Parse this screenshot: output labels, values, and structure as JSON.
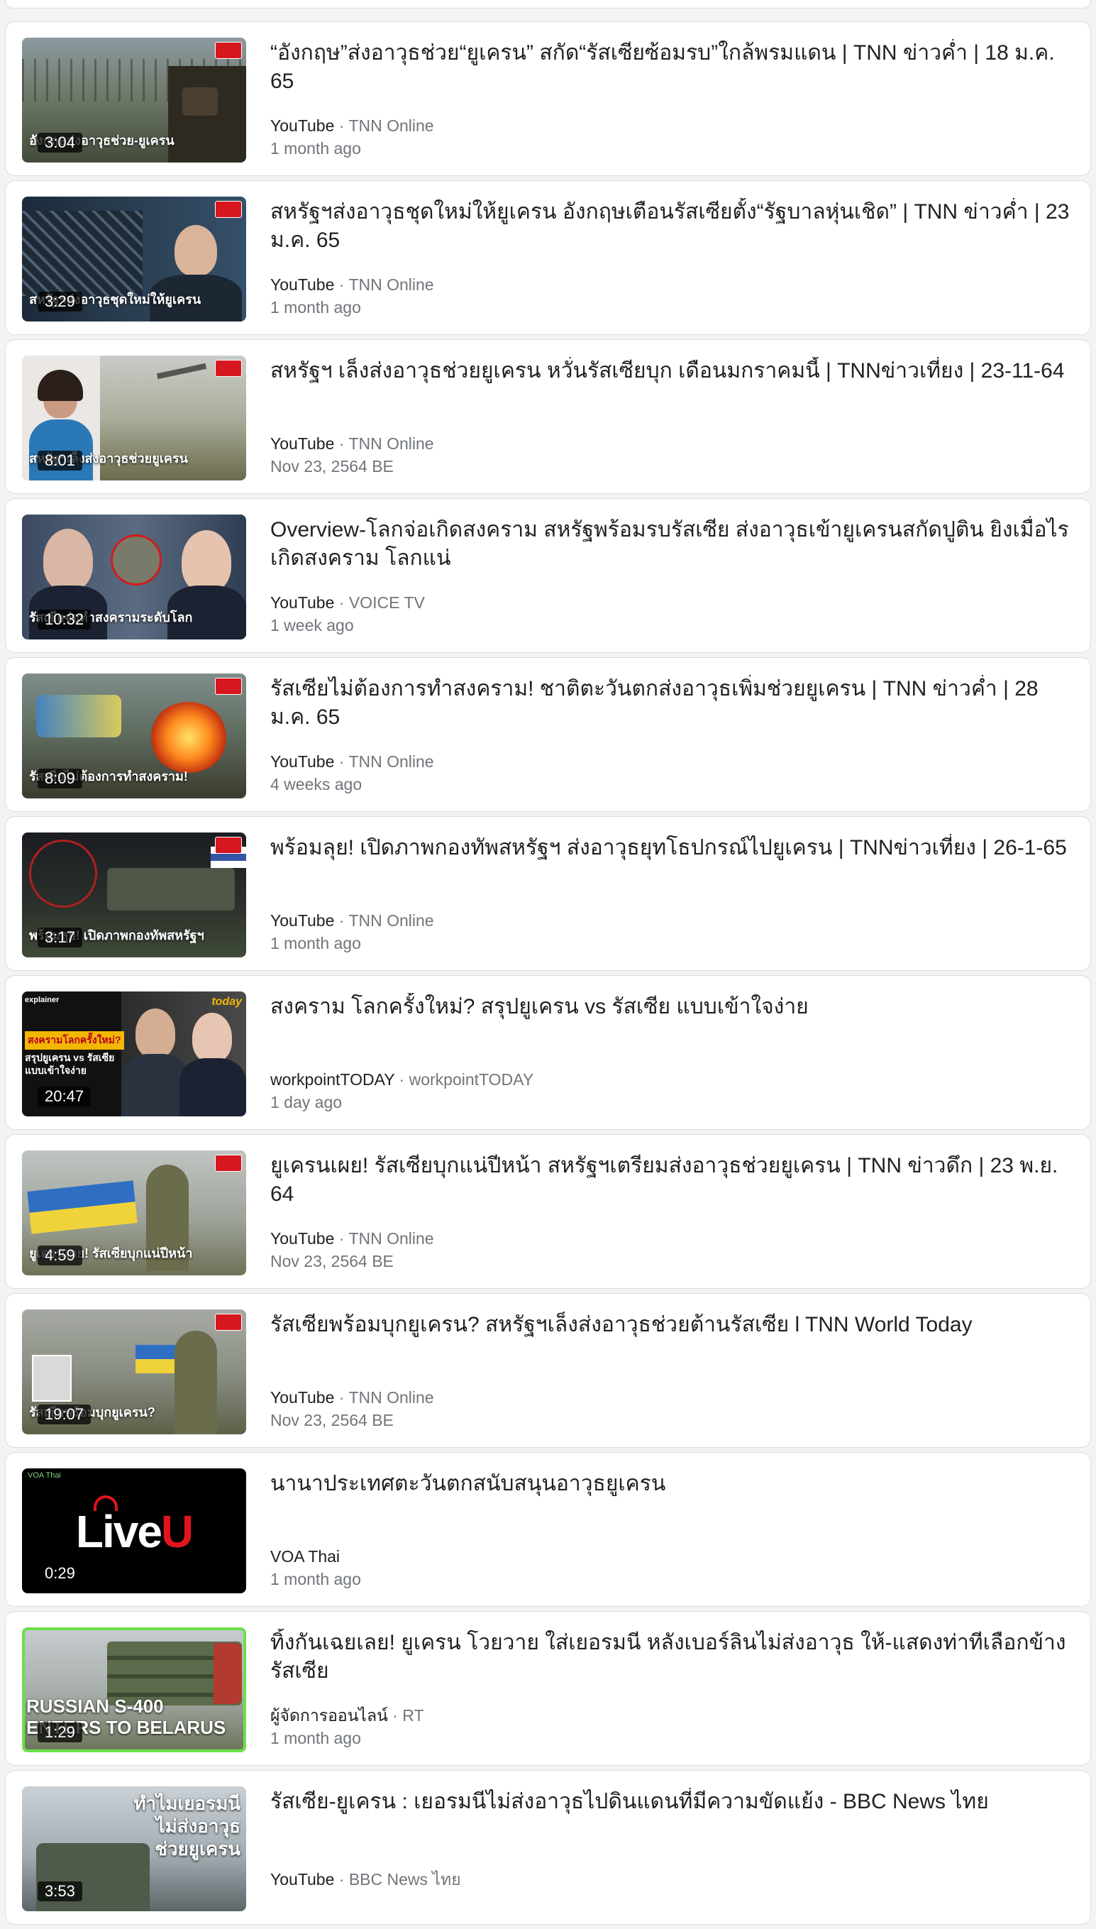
{
  "results": [
    {
      "title": "“อังกฤษ”ส่งอาวุธช่วย“ยูเครน” สกัด“รัสเซียซ้อมรบ”ใกล้พรมแดน | TNN ข่าวค่ำ | 18 ม.ค. 65",
      "source": "YouTube",
      "channel": "TNN Online",
      "date": "1 month ago",
      "duration": "3:04",
      "thumb_text": "อังกฤษส่งอาวุธช่วย-ยูเครน"
    },
    {
      "title": "สหรัฐฯส่งอาวุธชุดใหม่ให้ยูเครน อังกฤษเตือนรัสเซียตั้ง“รัฐบาลหุ่นเชิด” | TNN ข่าวค่ำ | 23 ม.ค. 65",
      "source": "YouTube",
      "channel": "TNN Online",
      "date": "1 month ago",
      "duration": "3:29",
      "thumb_text": "สหรัฐฯส่งอาวุธชุดใหม่ให้ยูเครน"
    },
    {
      "title": "สหรัฐฯ เล็งส่งอาวุธช่วยยูเครน หวั่นรัสเซียบุก เดือนมกราคมนี้ | TNNข่าวเที่ยง | 23-11-64",
      "source": "YouTube",
      "channel": "TNN Online",
      "date": "Nov 23, 2564 BE",
      "duration": "8:01",
      "thumb_text": "สหรัฐฯเล็งส่งอาวุธช่วยยูเครน"
    },
    {
      "title": "Overview-โลกจ่อเกิดสงคราม สหรัฐพร้อมรบรัสเซีย ส่งอาวุธเข้ายูเครนสกัดปูติน ยิงเมื่อไรเกิดสงคราม โลกแน่",
      "source": "YouTube",
      "channel": "VOICE TV",
      "date": "1 week ago",
      "duration": "10:32",
      "thumb_text": "รัสเซียจ่อทำสงครามระดับโลก"
    },
    {
      "title": "รัสเซียไม่ต้องการทำสงคราม! ชาติตะวันตกส่งอาวุธเพิ่มช่วยยูเครน | TNN ข่าวค่ำ | 28 ม.ค. 65",
      "source": "YouTube",
      "channel": "TNN Online",
      "date": "4 weeks ago",
      "duration": "8:09",
      "thumb_text": "รัสเซียไม่ต้องการทำสงคราม!"
    },
    {
      "title": "พร้อมลุย! เปิดภาพกองทัพสหรัฐฯ ส่งอาวุธยุทโธปกรณ์ไปยูเครน | TNNข่าวเที่ยง | 26-1-65",
      "source": "YouTube",
      "channel": "TNN Online",
      "date": "1 month ago",
      "duration": "3:17",
      "thumb_text": "พร้อมลุย! เปิดภาพกองทัพสหรัฐฯ"
    },
    {
      "title": "สงคราม โลกครั้งใหม่? สรุปยูเครน vs รัสเซีย แบบเข้าใจง่าย",
      "source": "workpointTODAY",
      "channel": "workpointTODAY",
      "date": "1 day ago",
      "duration": "20:47",
      "thumb_label": "explainer",
      "thumb_tag": "สงครามโลกครั้งใหม่?",
      "thumb_lines": [
        "สรุปยูเครน vs รัสเซีย",
        "แบบเข้าใจง่าย"
      ],
      "thumb_logo": "today"
    },
    {
      "title": "ยูเครนเผย! รัสเซียบุกแน่ปีหน้า สหรัฐฯเตรียมส่งอาวุธช่วยยูเครน | TNN ข่าวดึก | 23 พ.ย. 64",
      "source": "YouTube",
      "channel": "TNN Online",
      "date": "Nov 23, 2564 BE",
      "duration": "4:59",
      "thumb_text": "ยูเครนเผย! รัสเซียบุกแน่ปีหน้า"
    },
    {
      "title": "รัสเซียพร้อมบุกยูเครน? สหรัฐฯเล็งส่งอาวุธช่วยต้านรัสเซีย l TNN World Today",
      "source": "YouTube",
      "channel": "TNN Online",
      "date": "Nov 23, 2564 BE",
      "duration": "19:07",
      "thumb_text": "รัสเซียพร้อมบุกยูเครน?"
    },
    {
      "title": "นานาประเทศตะวันตกสนับสนุนอาวุธยูเครน",
      "source": "VOA Thai",
      "channel": "",
      "date": "1 month ago",
      "duration": "0:29",
      "thumb_brand_a": "Liv",
      "thumb_brand_b": "e",
      "thumb_brand_c": "U",
      "thumb_small": "VOA Thai"
    },
    {
      "title": "ทิ้งกันเฉยเลย! ยูเครน โวยวาย ใส่เยอรมนี หลังเบอร์ลินไม่ส่งอาวุธ ให้-แสดงท่าทีเลือกข้างรัสเซีย",
      "source": "ผู้จัดการออนไลน์",
      "channel": "RT",
      "date": "1 month ago",
      "duration": "1:29",
      "thumb_lines": [
        "RUSSIAN S-400",
        "ENTERS TO BELARUS"
      ]
    },
    {
      "title": "รัสเซีย-ยูเครน : เยอรมนีไม่ส่งอาวุธไปดินแดนที่มีความขัดแย้ง - BBC News ไทย",
      "source": "YouTube",
      "channel": "BBC News ไทย",
      "date": "",
      "duration": "3:53",
      "thumb_lines": [
        "ทำไมเยอรมนี",
        "ไม่ส่งอาวุธ",
        "ช่วยยูเครน"
      ]
    }
  ],
  "meta_separator": "·",
  "colors": {
    "page_bg": "#f1f3f4",
    "card_bg": "#ffffff",
    "card_border": "#dadce0",
    "title": "#202124",
    "meta": "#70757a",
    "tnn_red": "#d7171f",
    "liveu_red": "#e0151d"
  }
}
